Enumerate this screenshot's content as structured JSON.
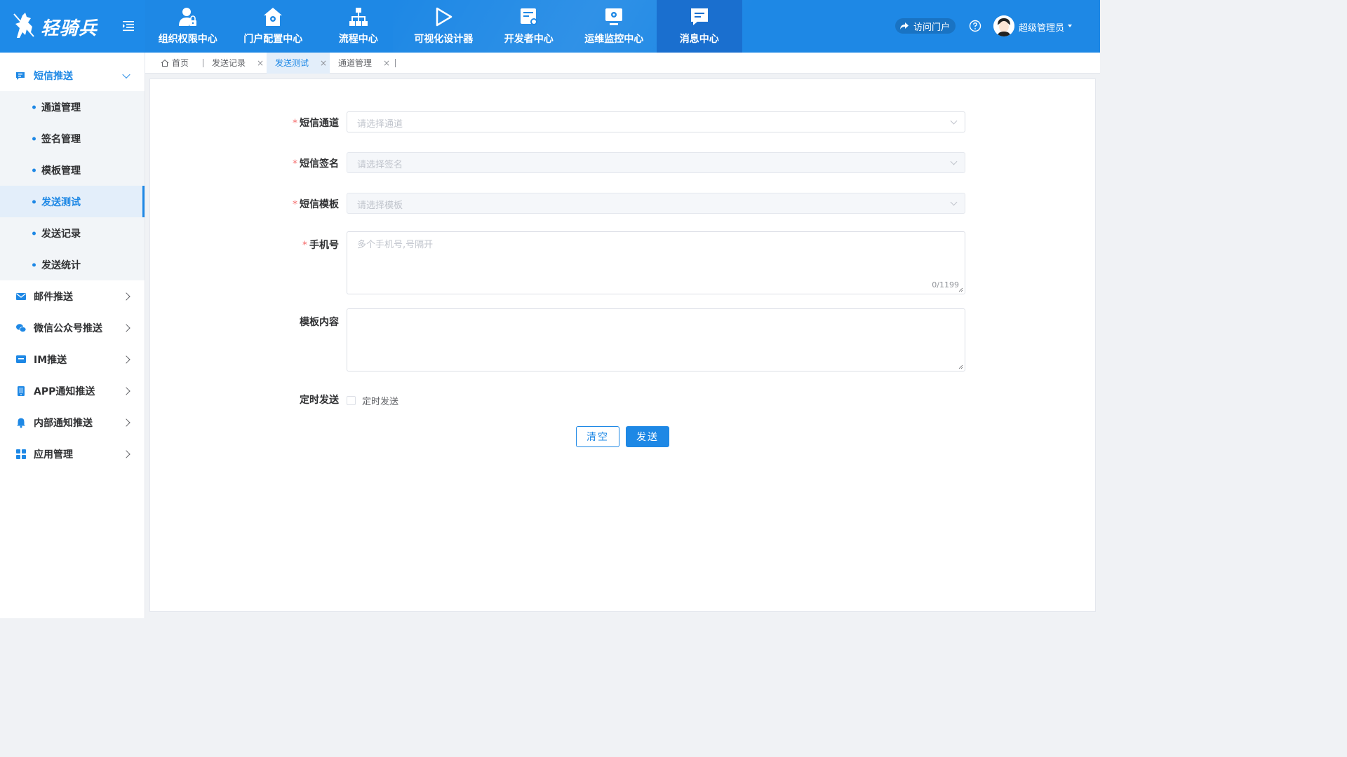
{
  "app": {
    "logo_text": "轻骑兵"
  },
  "nav": {
    "items": [
      {
        "label": "组织权限中心",
        "icon": "user-lock-icon"
      },
      {
        "label": "门户配置中心",
        "icon": "home-gear-icon"
      },
      {
        "label": "流程中心",
        "icon": "sitemap-icon"
      },
      {
        "label": "可视化设计器",
        "icon": "play-outline-icon"
      },
      {
        "label": "开发者中心",
        "icon": "doc-gear-icon"
      },
      {
        "label": "运维监控中心",
        "icon": "monitor-gear-icon"
      },
      {
        "label": "消息中心",
        "icon": "message-icon"
      }
    ],
    "active_index": 6
  },
  "header": {
    "portal_label": "访问门户",
    "user_name": "超级管理员"
  },
  "sidebar": {
    "groups": [
      {
        "label": "短信推送",
        "icon": "sms-icon",
        "open": true,
        "items": [
          {
            "label": "通道管理"
          },
          {
            "label": "签名管理"
          },
          {
            "label": "模板管理"
          },
          {
            "label": "发送测试",
            "active": true
          },
          {
            "label": "发送记录"
          },
          {
            "label": "发送统计"
          }
        ]
      },
      {
        "label": "邮件推送",
        "icon": "mail-icon"
      },
      {
        "label": "微信公众号推送",
        "icon": "wechat-icon"
      },
      {
        "label": "IM推送",
        "icon": "im-icon"
      },
      {
        "label": "APP通知推送",
        "icon": "phone-icon"
      },
      {
        "label": "内部通知推送",
        "icon": "bell-icon"
      },
      {
        "label": "应用管理",
        "icon": "apps-grid-icon"
      }
    ]
  },
  "tabs": {
    "home": "首页",
    "items": [
      {
        "label": "发送记录"
      },
      {
        "label": "发送测试",
        "active": true
      },
      {
        "label": "通道管理"
      }
    ],
    "close_glyph": "×"
  },
  "form": {
    "channel": {
      "label": "短信通道",
      "placeholder": "请选择通道",
      "required": true
    },
    "signature": {
      "label": "短信签名",
      "placeholder": "请选择签名",
      "required": true
    },
    "template": {
      "label": "短信模板",
      "placeholder": "请选择模板",
      "required": true
    },
    "phone": {
      "label": "手机号",
      "placeholder": "多个手机号,号隔开",
      "counter": "0/1199",
      "required": true
    },
    "content": {
      "label": "模板内容",
      "value": ""
    },
    "schedule": {
      "label": "定时发送",
      "checkbox_label": "定时发送",
      "checked": false
    },
    "required_mark": "*",
    "buttons": {
      "clear": "清空",
      "send": "发送"
    }
  },
  "colors": {
    "primary": "#1e88e5",
    "nav_active": "#1a6fcf",
    "required": "#f56c6c"
  }
}
